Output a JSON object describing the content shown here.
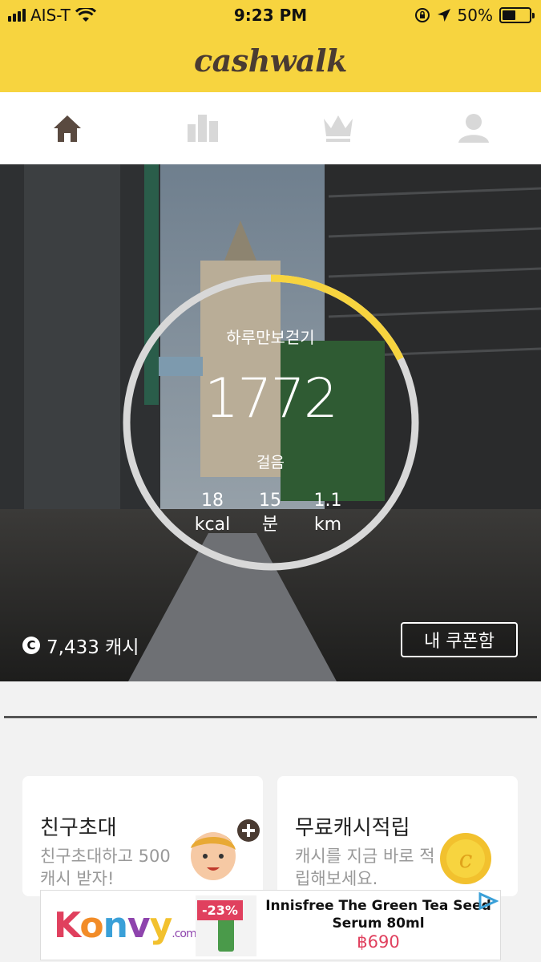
{
  "status_bar": {
    "carrier": "AIS-T",
    "time": "9:23 PM",
    "battery": "50%",
    "battery_level": 0.5,
    "icons": [
      "signal-icon",
      "wifi-icon",
      "orientation-lock-icon",
      "location-arrow-icon",
      "battery-icon"
    ]
  },
  "header": {
    "logo": "cashwalk"
  },
  "tabs": [
    {
      "name": "home",
      "icon": "home-icon",
      "active": true
    },
    {
      "name": "ranking",
      "icon": "bar-chart-icon",
      "active": false
    },
    {
      "name": "crown",
      "icon": "crown-icon",
      "active": false
    },
    {
      "name": "profile",
      "icon": "person-icon",
      "active": false
    }
  ],
  "tracker": {
    "goal_label": "하루만보걷기",
    "steps": "1772",
    "steps_unit": "걸음",
    "goal_progress": 0.1772,
    "stats": [
      {
        "value": "18",
        "unit": "kcal"
      },
      {
        "value": "15",
        "unit": "분"
      },
      {
        "value": "1.1",
        "unit": "km"
      }
    ]
  },
  "cash": {
    "coin_symbol": "C",
    "amount": "7,433 캐시"
  },
  "coupon_button": "내 쿠폰함",
  "cards": [
    {
      "title": "친구초대",
      "desc": "친구초대하고 500캐시 받자!",
      "icon": "friend-avatar-icon"
    },
    {
      "title": "무료캐시적립",
      "desc": "캐시를 지금 바로 적립해보세요.",
      "icon": "gold-coin-icon"
    }
  ],
  "ad": {
    "brand": "Konvy",
    "brand_suffix": ".com",
    "discount": "-23%",
    "title": "Innisfree The Green Tea Seed Serum 80ml",
    "price": "฿690"
  },
  "colors": {
    "brand_yellow": "#f7d43f",
    "ring_progress": "#f7d43f",
    "ring_track": "#d8d8d8",
    "price": "#e0405e"
  }
}
